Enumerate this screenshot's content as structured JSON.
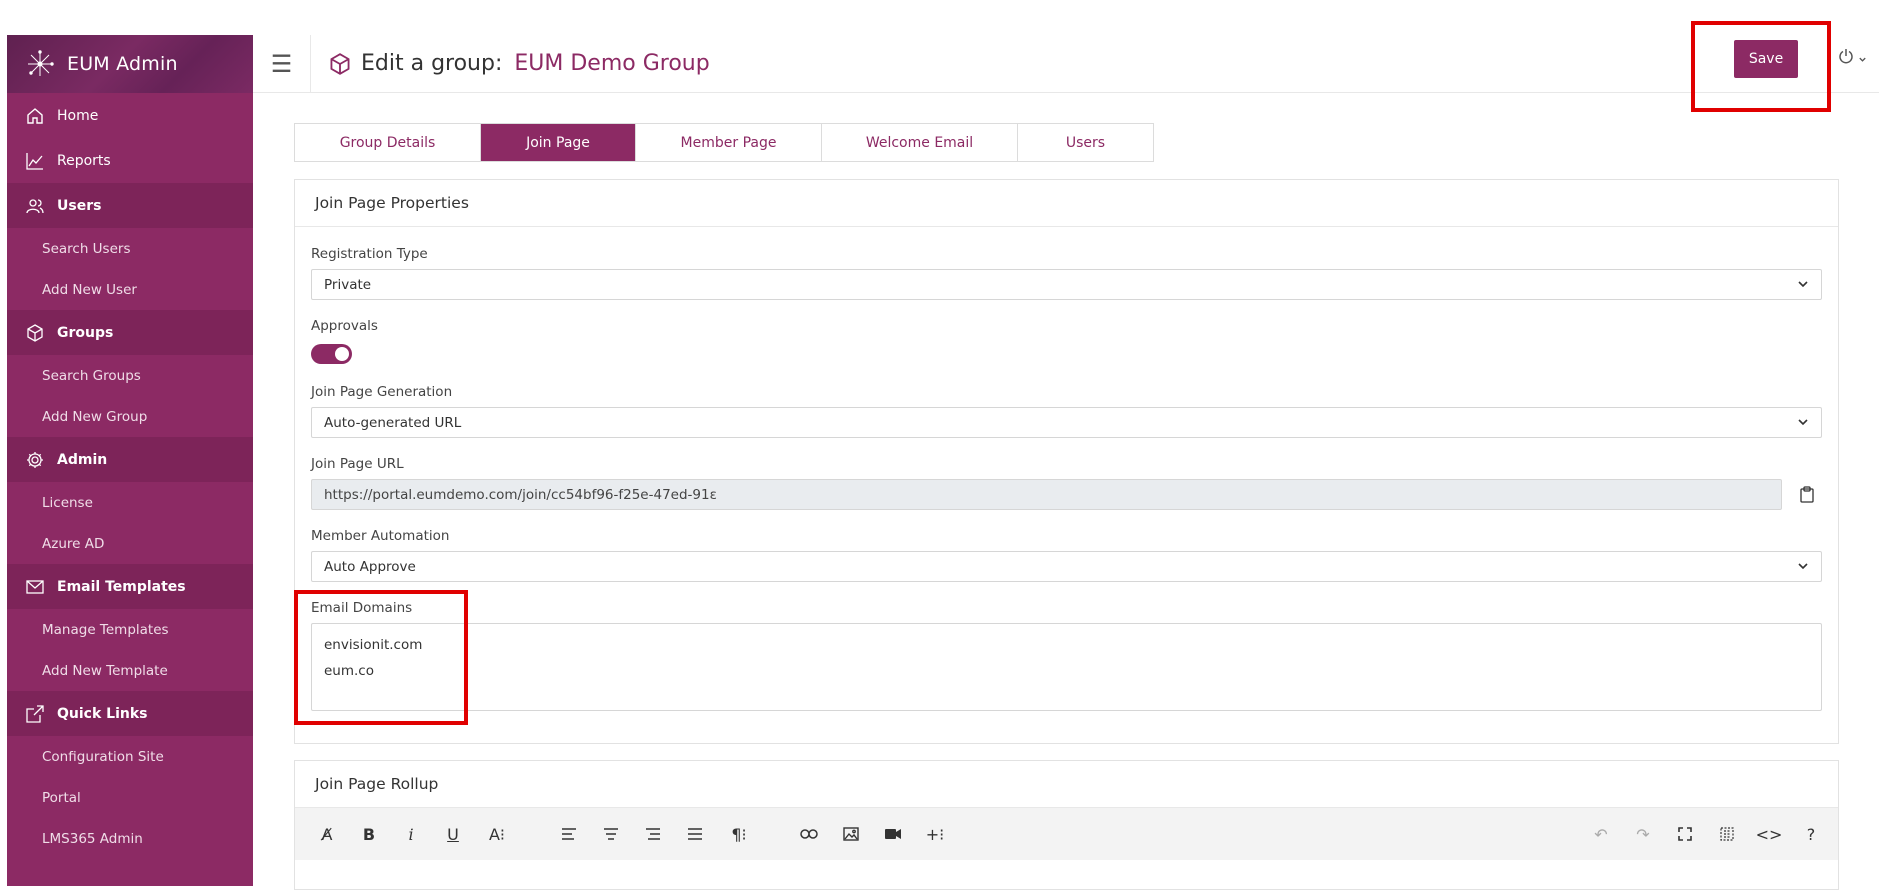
{
  "app": {
    "brand": "EUM Admin"
  },
  "sidebar": {
    "items": [
      {
        "type": "item",
        "label": "Home",
        "icon": "home-icon"
      },
      {
        "type": "item",
        "label": "Reports",
        "icon": "chart-line-icon"
      },
      {
        "type": "section",
        "label": "Users",
        "icon": "users-icon"
      },
      {
        "type": "sub",
        "label": "Search Users"
      },
      {
        "type": "sub",
        "label": "Add New User"
      },
      {
        "type": "section",
        "label": "Groups",
        "icon": "cube-icon"
      },
      {
        "type": "sub",
        "label": "Search Groups"
      },
      {
        "type": "sub",
        "label": "Add New Group"
      },
      {
        "type": "section",
        "label": "Admin",
        "icon": "gear-icon"
      },
      {
        "type": "sub",
        "label": "License"
      },
      {
        "type": "sub",
        "label": "Azure AD"
      },
      {
        "type": "section",
        "label": "Email Templates",
        "icon": "envelope-icon"
      },
      {
        "type": "sub",
        "label": "Manage Templates"
      },
      {
        "type": "sub",
        "label": "Add New Template"
      },
      {
        "type": "section",
        "label": "Quick Links",
        "icon": "external-link-icon"
      },
      {
        "type": "sub",
        "label": "Configuration Site"
      },
      {
        "type": "sub",
        "label": "Portal"
      },
      {
        "type": "sub",
        "label": "LMS365 Admin"
      }
    ]
  },
  "header": {
    "title_prefix": "Edit a group:",
    "group_name": "EUM Demo Group",
    "save_label": "Save"
  },
  "tabs": [
    {
      "label": "Group Details",
      "active": false
    },
    {
      "label": "Join Page",
      "active": true
    },
    {
      "label": "Member Page",
      "active": false
    },
    {
      "label": "Welcome Email",
      "active": false
    },
    {
      "label": "Users",
      "active": false
    }
  ],
  "join_properties": {
    "title": "Join Page Properties",
    "registration_type": {
      "label": "Registration Type",
      "value": "Private"
    },
    "approvals": {
      "label": "Approvals",
      "enabled": true
    },
    "generation": {
      "label": "Join Page Generation",
      "value": "Auto-generated URL"
    },
    "url": {
      "label": "Join Page URL",
      "value": "https://portal.eumdemo.com/join/cc54bf96-f25e-47ed-91ε"
    },
    "automation": {
      "label": "Member Automation",
      "value": "Auto Approve"
    },
    "domains": {
      "label": "Email Domains",
      "lines": [
        "envisionit.com",
        "eum.co"
      ]
    }
  },
  "rollup": {
    "title": "Join Page Rollup"
  },
  "colors": {
    "brand": "#8c2a64",
    "highlight": "#e00000"
  }
}
